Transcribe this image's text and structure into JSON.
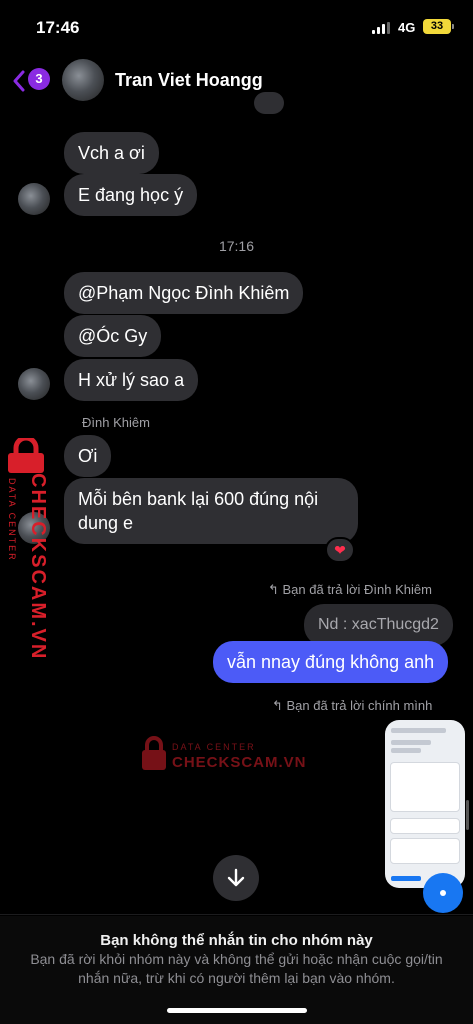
{
  "status_bar": {
    "time": "17:46",
    "network": "4G",
    "battery": "33"
  },
  "header": {
    "back_count": "3",
    "title": "Tran Viet Hoangg"
  },
  "messages": {
    "m1": "Vch a ơi",
    "m2": "E đang học ý",
    "timestamp": "17:16",
    "m3": "@Phạm Ngọc Đình Khiêm",
    "m4": "@Óc Gy",
    "m5": "H xử lý sao a",
    "sender_name": "Đình Khiêm",
    "m6": "Ơi",
    "m7": "Mỗi bên bank lại 600 đúng nội dung e",
    "m7_reaction": "❤",
    "reply1_meta": "Bạn đã trả lời Đình Khiêm",
    "reply1_quote": "Nd : xacThucgd2",
    "reply1_text": "vẫn nnay đúng không anh",
    "reply2_meta": "Bạn đã trả lời chính mình"
  },
  "footer": {
    "title": "Bạn không thể nhắn tin cho nhóm này",
    "body": "Bạn đã rời khỏi nhóm này và không thể gửi hoặc nhận cuộc gọi/tin nhắn nữa, trừ khi có người thêm lại bạn vào nhóm."
  },
  "watermark": {
    "small": "DATA CENTER",
    "big": "CHECKSCAM.VN"
  },
  "colors": {
    "accent_purple": "#8a2be2",
    "my_bubble": "#4c5bf7",
    "their_bubble": "#2f2f33",
    "watermark_red": "#d81f2a"
  }
}
